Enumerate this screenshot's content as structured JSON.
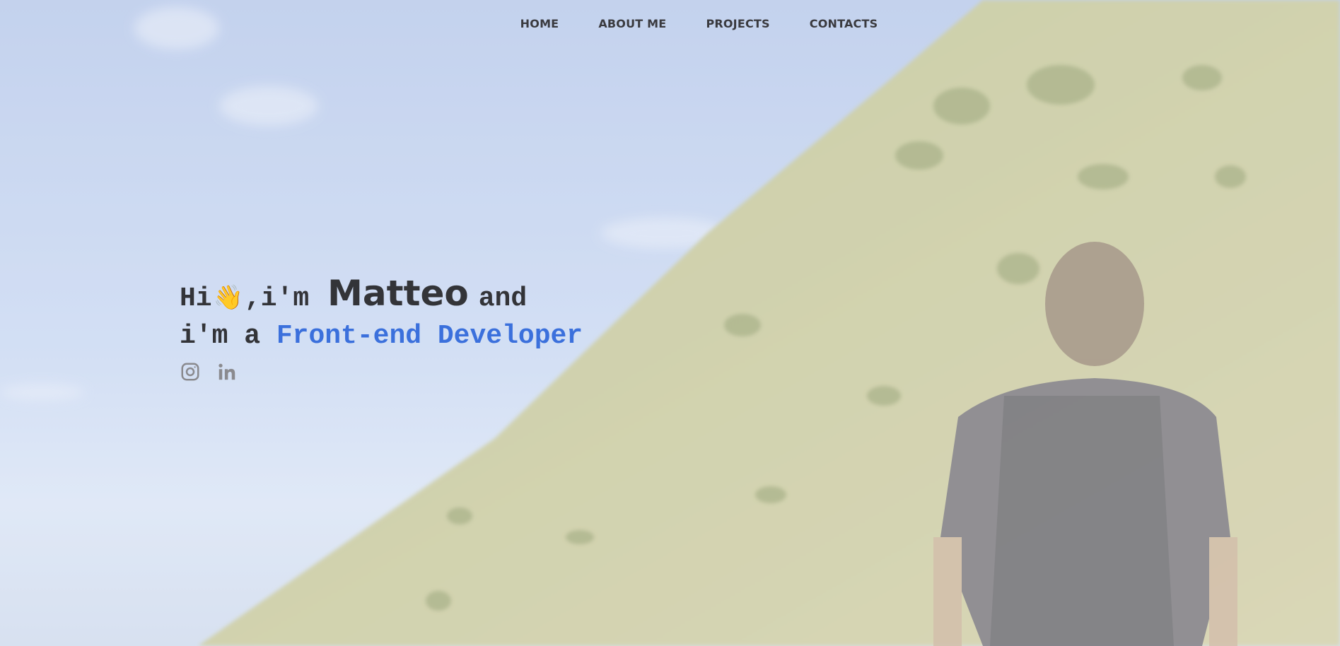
{
  "nav": {
    "items": [
      {
        "label": "HOME"
      },
      {
        "label": "ABOUT ME"
      },
      {
        "label": "PROJECTS"
      },
      {
        "label": "CONTACTS"
      }
    ]
  },
  "hero": {
    "greeting": "Hi",
    "wave_emoji": "👋",
    "intro": ",i'm",
    "name": "Matteo",
    "conjunction": "and",
    "role_prefix": "i'm a",
    "role": "Front-end Developer"
  },
  "socials": {
    "icons": [
      "instagram-icon",
      "linkedin-icon"
    ]
  },
  "colors": {
    "text": "#333438",
    "accent": "#3b70dc",
    "icon": "#8a8a8e"
  }
}
